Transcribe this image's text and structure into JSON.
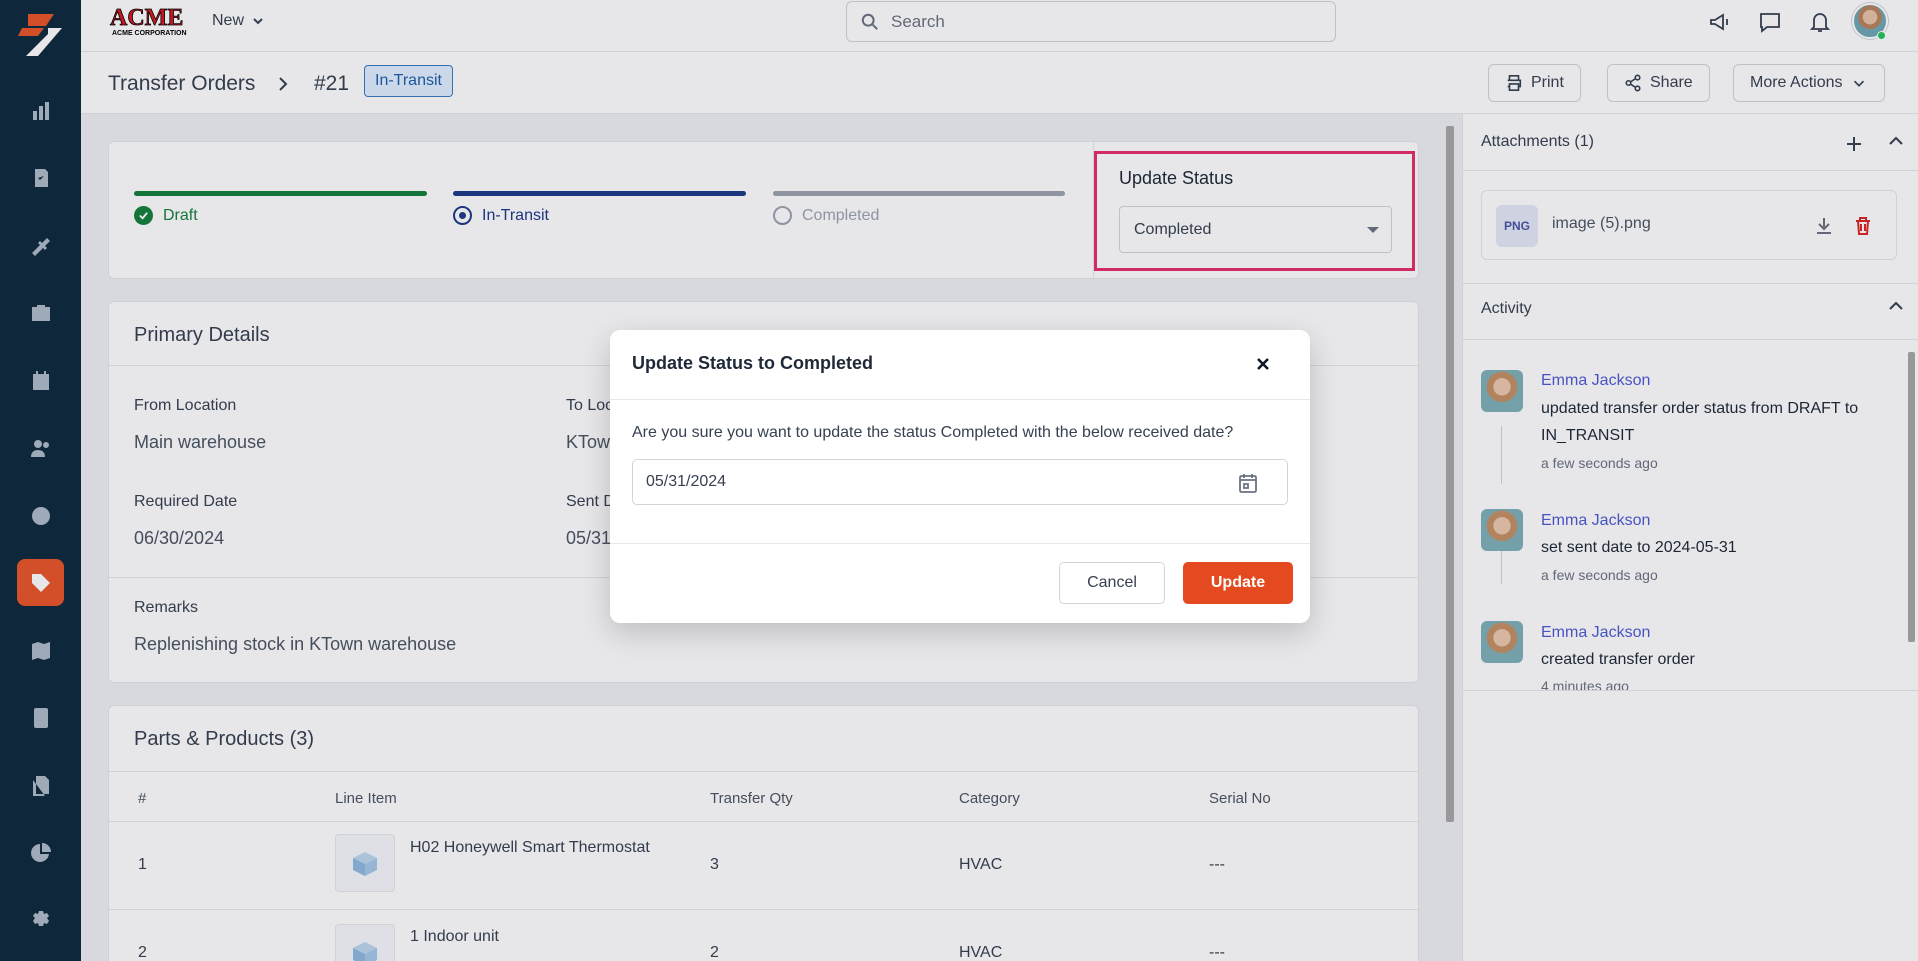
{
  "header": {
    "brand": "ACME CORPORATION",
    "new_label": "New",
    "search_placeholder": "Search"
  },
  "breadcrumb": {
    "parent": "Transfer Orders",
    "id": "#21",
    "status_badge": "In-Transit",
    "actions": {
      "print": "Print",
      "share": "Share",
      "more": "More Actions"
    }
  },
  "progress": {
    "steps": [
      {
        "label": "Draft",
        "state": "done",
        "color": "#15803d"
      },
      {
        "label": "In-Transit",
        "state": "current",
        "color": "#1e3a8a"
      },
      {
        "label": "Completed",
        "state": "pending",
        "color": "#9ca3af"
      }
    ],
    "update_status_title": "Update Status",
    "update_status_value": "Completed"
  },
  "primary": {
    "title": "Primary Details",
    "from_location_label": "From Location",
    "from_location_value": "Main warehouse",
    "to_location_label": "To Loc",
    "to_location_value": "KTow",
    "required_date_label": "Required Date",
    "required_date_value": "06/30/2024",
    "sent_date_label": "Sent D",
    "sent_date_value": "05/31",
    "remarks_label": "Remarks",
    "remarks_value": "Replenishing stock in KTown warehouse"
  },
  "parts": {
    "title": "Parts & Products (3)",
    "columns": [
      "#",
      "Line Item",
      "Transfer Qty",
      "Category",
      "Serial No"
    ],
    "rows": [
      {
        "num": "1",
        "item": "H02 Honeywell Smart Thermostat",
        "qty": "3",
        "category": "HVAC",
        "serial": "---"
      },
      {
        "num": "2",
        "item": "1 Indoor unit",
        "qty": "2",
        "category": "HVAC",
        "serial": "---"
      }
    ]
  },
  "attachments": {
    "title": "Attachments (1)",
    "file_type": "PNG",
    "file_name": "image (5).png"
  },
  "activity": {
    "title": "Activity",
    "items": [
      {
        "user": "Emma Jackson",
        "text": "updated transfer order status from DRAFT to IN_TRANSIT",
        "time": "a few seconds ago"
      },
      {
        "user": "Emma Jackson",
        "text": "set sent date to 2024-05-31",
        "time": "a few seconds ago"
      },
      {
        "user": "Emma Jackson",
        "text": "created transfer order",
        "time": "4 minutes ago"
      }
    ]
  },
  "modal": {
    "title": "Update Status to Completed",
    "message": "Are you sure you want to update the status Completed with the below received date?",
    "date_value": "05/31/2024",
    "cancel_label": "Cancel",
    "update_label": "Update"
  },
  "colors": {
    "sidebar_bg": "#0e2a3d",
    "accent": "#e5491f",
    "highlight_border": "#e62e6b",
    "link": "#4f5bd5"
  },
  "sidebar_icons": [
    "reports-icon",
    "work-orders-icon",
    "tools-icon",
    "briefcase-icon",
    "calendar-icon",
    "people-icon",
    "clock-icon",
    "tag-icon",
    "map-icon",
    "calculator-icon",
    "documents-icon",
    "pie-chart-icon",
    "settings-icon"
  ]
}
